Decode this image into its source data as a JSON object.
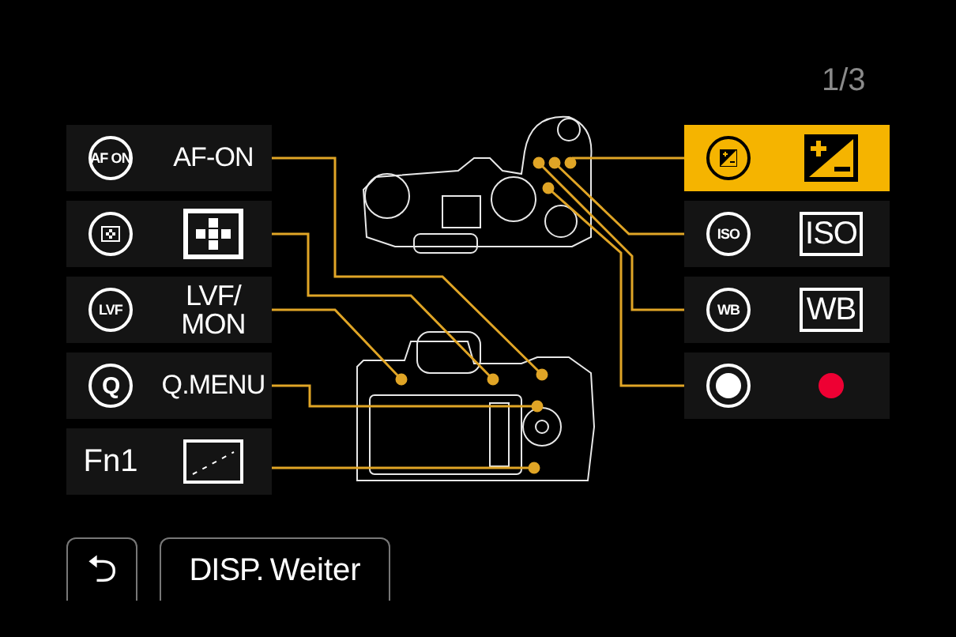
{
  "page_indicator": "1/3",
  "left_buttons": [
    {
      "badge": {
        "kind": "circle_text",
        "text": "AF ON"
      },
      "function": {
        "kind": "text",
        "text": "AF-ON"
      },
      "selected": false
    },
    {
      "badge": {
        "kind": "circle_grid"
      },
      "function": {
        "kind": "grid"
      },
      "selected": false
    },
    {
      "badge": {
        "kind": "circle_text",
        "text": "LVF"
      },
      "function": {
        "kind": "text",
        "text": "LVF/\nMON"
      },
      "selected": false
    },
    {
      "badge": {
        "kind": "circle_text",
        "text": "Q"
      },
      "function": {
        "kind": "text",
        "text": "Q.MENU"
      },
      "selected": false
    },
    {
      "badge": {
        "kind": "plain_text",
        "text": "Fn1"
      },
      "function": {
        "kind": "touch"
      },
      "selected": false
    }
  ],
  "right_buttons": [
    {
      "badge": {
        "kind": "circle_plus_minus"
      },
      "function": {
        "kind": "plus_minus"
      },
      "selected": true
    },
    {
      "badge": {
        "kind": "circle_text",
        "text": "ISO"
      },
      "function": {
        "kind": "boxed_text",
        "text": "ISO"
      },
      "selected": false
    },
    {
      "badge": {
        "kind": "circle_text",
        "text": "WB"
      },
      "function": {
        "kind": "boxed_text",
        "text": "WB"
      },
      "selected": false
    },
    {
      "badge": {
        "kind": "circle_dot"
      },
      "function": {
        "kind": "dot"
      },
      "selected": false
    }
  ],
  "footer": {
    "back_button": "⮌",
    "disp_button": {
      "key": "DISP.",
      "label": "Weiter"
    }
  }
}
